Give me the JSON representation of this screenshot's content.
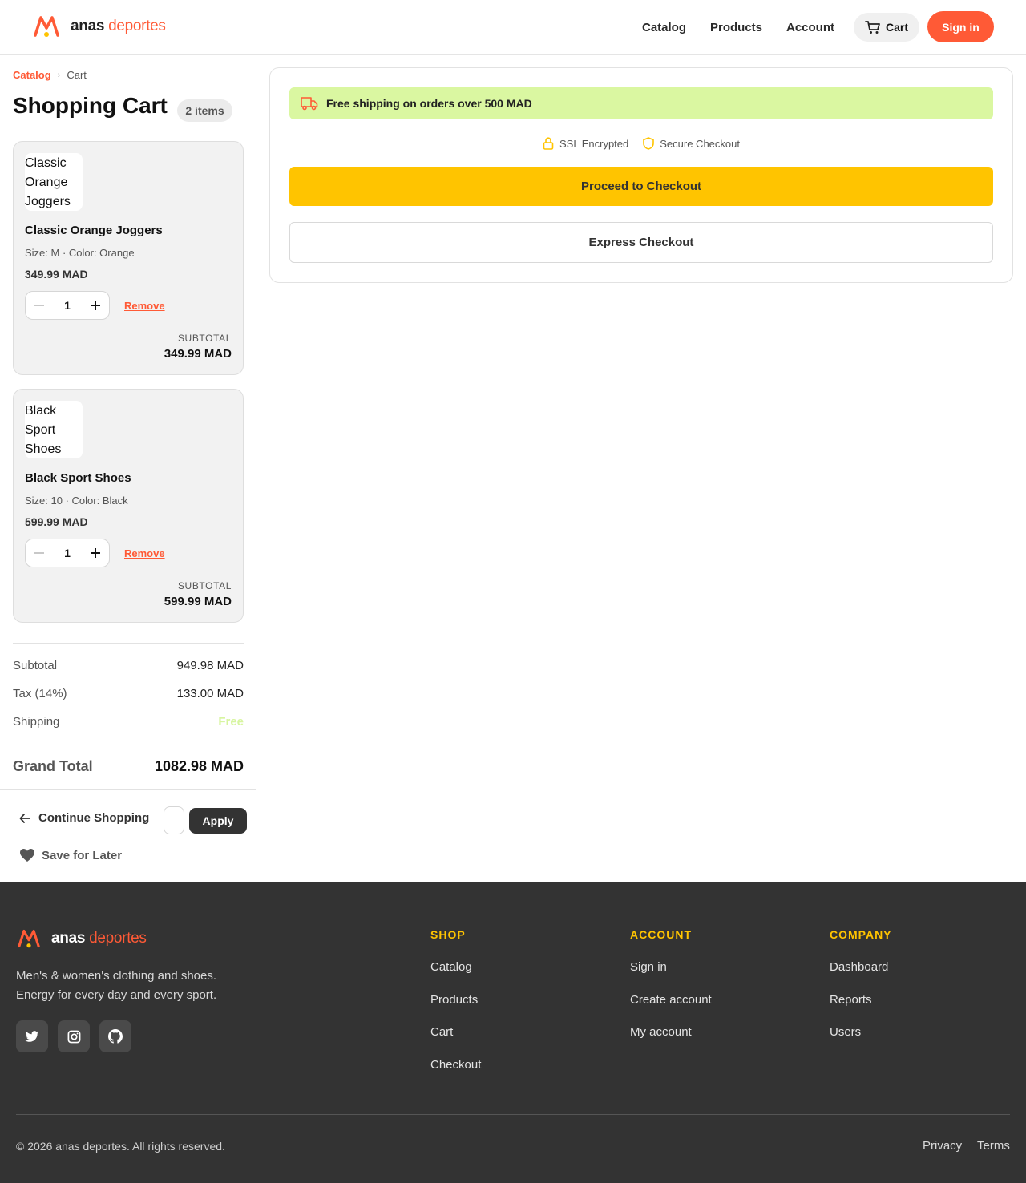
{
  "brand": {
    "word1": "anas",
    "word2": "deportes",
    "accent_color": "#ff5a36",
    "logo_icon": "m-logo-icon"
  },
  "nav": {
    "links": [
      "Catalog",
      "Products",
      "Account"
    ],
    "cart_label": "Cart",
    "signin_label": "Sign in"
  },
  "breadcrumb": {
    "parent": "Catalog",
    "current": "Cart"
  },
  "page": {
    "title": "Shopping Cart",
    "items_badge": "2 items"
  },
  "cart_items": [
    {
      "image_alt": "Classic Orange Joggers",
      "name": "Classic Orange Joggers",
      "meta": "Size: M · Color: Orange",
      "price": "349.99 MAD",
      "quantity": "1",
      "remove_label": "Remove",
      "subtotal_label": "SUBTOTAL",
      "subtotal": "349.99 MAD"
    },
    {
      "image_alt": "Black Sport Shoes",
      "name": "Black Sport Shoes",
      "meta": "Size: 10 · Color: Black",
      "price": "599.99 MAD",
      "quantity": "1",
      "remove_label": "Remove",
      "subtotal_label": "SUBTOTAL",
      "subtotal": "599.99 MAD"
    }
  ],
  "summary": {
    "subtotal_label": "Subtotal",
    "subtotal": "949.98 MAD",
    "tax_label": "Tax (14%)",
    "tax": "133.00 MAD",
    "shipping_label": "Shipping",
    "shipping": "Free",
    "grand_total_label": "Grand Total",
    "grand_total": "1082.98 MAD"
  },
  "actions": {
    "continue_label": "Continue Shopping",
    "promo_placeholder": "",
    "apply_label": "Apply",
    "save_later_label": "Save for Later"
  },
  "checkout_panel": {
    "shipping_banner": "Free shipping on orders over 500 MAD",
    "ssl_label": "SSL Encrypted",
    "secure_label": "Secure Checkout",
    "proceed_label": "Proceed to Checkout",
    "express_label": "Express Checkout",
    "banner_color": "#daf7a1",
    "proceed_color": "#ffc400"
  },
  "footer": {
    "description_line1": "Men's & women's clothing and shoes.",
    "description_line2": "Energy for every day and every sport.",
    "socials": [
      "twitter-icon",
      "instagram-icon",
      "github-icon"
    ],
    "columns": [
      {
        "title": "SHOP",
        "links": [
          "Catalog",
          "Products",
          "Cart",
          "Checkout"
        ]
      },
      {
        "title": "ACCOUNT",
        "links": [
          "Sign in",
          "Create account",
          "My account"
        ]
      },
      {
        "title": "COMPANY",
        "links": [
          "Dashboard",
          "Reports",
          "Users"
        ]
      }
    ],
    "copyright": "© 2026 anas deportes. All rights reserved.",
    "privacy_label": "Privacy",
    "terms_label": "Terms",
    "background": "#333333",
    "heading_color": "#ffc400"
  }
}
